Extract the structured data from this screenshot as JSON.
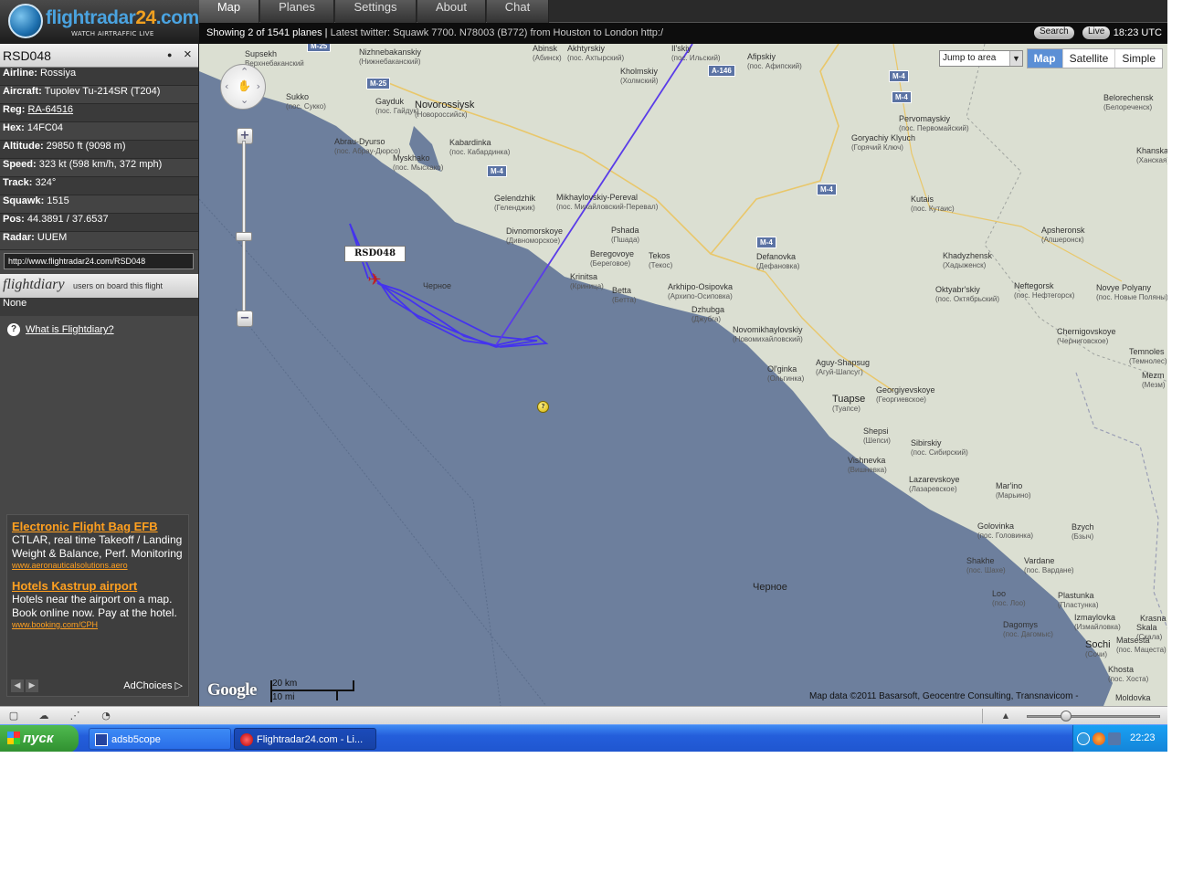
{
  "app": {
    "logo_text_a": "flightradar",
    "logo_text_b": "24",
    "logo_text_c": ".com",
    "logo_tagline": "WATCH AIRTRAFFIC LIVE"
  },
  "nav": {
    "tabs": [
      {
        "label": "Map",
        "active": true
      },
      {
        "label": "Planes"
      },
      {
        "label": "Settings"
      },
      {
        "label": "About"
      },
      {
        "label": "Chat"
      }
    ]
  },
  "status": {
    "showing": "Showing 2 of 1541 planes",
    "separator": "|",
    "twitter": "Latest twitter: Squawk 7700. N78003 (B772) from Houston to London http://t...",
    "search_label": "Search",
    "live_label": "Live",
    "clock": "18:23 UTC"
  },
  "flight": {
    "callsign": "RSD048",
    "pin_icon": "●",
    "close_icon": "×",
    "fields": [
      {
        "label": "Airline:",
        "value": "Rossiya"
      },
      {
        "label": "Aircraft:",
        "value": "Tupolev Tu-214SR (T204)"
      },
      {
        "label": "Reg:",
        "value": "RA-64516",
        "link": true
      },
      {
        "label": "Hex:",
        "value": "14FC04"
      },
      {
        "label": "Altitude:",
        "value": "29850 ft (9098 m)"
      },
      {
        "label": "Speed:",
        "value": "323 kt (598 km/h, 372 mph)"
      },
      {
        "label": "Track:",
        "value": "324°"
      },
      {
        "label": "Squawk:",
        "value": "1515"
      },
      {
        "label": "Pos:",
        "value": "44.3891 / 37.6537"
      },
      {
        "label": "Radar:",
        "value": "UUEM"
      }
    ],
    "url": "http://www.flightradar24.com/RSD048",
    "flightdiary_brand": "flightdiary",
    "flightdiary_desc": "users on board this flight",
    "flightdiary_value": "None",
    "flightdiary_help": "What is Flightdiary?"
  },
  "ads": {
    "items": [
      {
        "title": "Electronic Flight Bag EFB",
        "text": "CTLAR, real time Takeoff / Landing Weight & Balance, Perf. Monitoring",
        "url": "www.aeronauticalsolutions.aero"
      },
      {
        "title": "Hotels Kastrup airport",
        "text": "Hotels near the airport on a map. Book online now. Pay at the hotel.",
        "url": "www.booking.com/CPH"
      }
    ],
    "adchoices": "AdChoices ▷"
  },
  "map": {
    "jump_label": "Jump to area",
    "types": [
      {
        "label": "Map",
        "active": true
      },
      {
        "label": "Satellite"
      },
      {
        "label": "Simple"
      }
    ],
    "flight_label": "RSD048",
    "balloon": "?",
    "google": "Google",
    "scale_km": "20 km",
    "scale_mi": "10 mi",
    "attribution": "Map data ©2011 Basarsoft, Geocentre Consulting, Transnavicom -",
    "sea_label": "Черное",
    "sea_label_small": "Черное",
    "places": [
      {
        "name": "Supsekh",
        "ru": "Верхнебаканский"
      },
      {
        "name": "Nizhnebakanskiy",
        "ru": "(Нижнебаканский)"
      },
      {
        "name": "Abinsk",
        "ru": "(Абинск)"
      },
      {
        "name": "Akhtyrskiy",
        "ru": "(пос. Ахтырский)"
      },
      {
        "name": "Il'skiy",
        "ru": "(пос. Ильский)"
      },
      {
        "name": "Kholmskiy",
        "ru": "(Холмский)"
      },
      {
        "name": "Afipskiy",
        "ru": "(пос. Афипский)"
      },
      {
        "name": "Sukko",
        "ru": "(пос. Сукко)"
      },
      {
        "name": "Gayduk",
        "ru": "(пос. Гайдук)"
      },
      {
        "name": "Novorossiysk",
        "ru": "(Новороссийск)"
      },
      {
        "name": "Kabardinka",
        "ru": "(пос. Кабардинка)"
      },
      {
        "name": "Abrau-Dyurso",
        "ru": "(пос. Абрау-Дюрсо)"
      },
      {
        "name": "Myskhako",
        "ru": "(пос. Мысхако)"
      },
      {
        "name": "Gelendzhik",
        "ru": "(Геленджик)"
      },
      {
        "name": "Mikhaylovskiy-Pereval",
        "ru": "(пос. Михайловский-Перевал)"
      },
      {
        "name": "Divnomorskoye",
        "ru": "(Дивноморское)"
      },
      {
        "name": "Pshada",
        "ru": "(Пшада)"
      },
      {
        "name": "Beregovoye",
        "ru": "(Береговое)"
      },
      {
        "name": "Tekos",
        "ru": "(Текос)"
      },
      {
        "name": "Krinitsa",
        "ru": "(Криница)"
      },
      {
        "name": "Betta",
        "ru": "(Бетта)"
      },
      {
        "name": "Arkhipo-Osipovka",
        "ru": "(Архипо-Осиповка)"
      },
      {
        "name": "Dzhubga",
        "ru": "(Джубга)"
      },
      {
        "name": "Defanovka",
        "ru": "(Дефановка)"
      },
      {
        "name": "Novomikhaylovskiy",
        "ru": "(Новомихайловский)"
      },
      {
        "name": "Ol'ginka",
        "ru": "(Ольгинка)"
      },
      {
        "name": "Aguy-Shapsug",
        "ru": "(Агуй-Шапсуг)"
      },
      {
        "name": "Tuapse",
        "ru": "(Туапсе)"
      },
      {
        "name": "Georgiyevskoye",
        "ru": "(Георгиевское)"
      },
      {
        "name": "Shepsi",
        "ru": "(Шепси)"
      },
      {
        "name": "Sibirskiy",
        "ru": "(пос. Сибирский)"
      },
      {
        "name": "Vishnevka",
        "ru": "(Вишневка)"
      },
      {
        "name": "Lazarevskoye",
        "ru": "(Лазаревское)"
      },
      {
        "name": "Mar'ino",
        "ru": "(Марьино)"
      },
      {
        "name": "Golovinka",
        "ru": "(пос. Головинка)"
      },
      {
        "name": "Bzych",
        "ru": "(Бзыч)"
      },
      {
        "name": "Shakhe",
        "ru": "(пос. Шахе)"
      },
      {
        "name": "Vardane",
        "ru": "(пос. Вардане)"
      },
      {
        "name": "Loo",
        "ru": "(пос. Лоо)"
      },
      {
        "name": "Plastunka",
        "ru": "(Пластунка)"
      },
      {
        "name": "Dagomys",
        "ru": "(пос. Дагомыс)"
      },
      {
        "name": "Izmaylovka",
        "ru": "(Измайловка)"
      },
      {
        "name": "Sochi",
        "ru": "(Сочи)"
      },
      {
        "name": "Matsesta",
        "ru": "(пос. Мацеста)"
      },
      {
        "name": "Khosta",
        "ru": "(пос. Хоста)"
      },
      {
        "name": "Goryachiy Klyuch",
        "ru": "(Горячий Ключ)"
      },
      {
        "name": "Pervomayskiy",
        "ru": "(пос. Первомайский)"
      },
      {
        "name": "Kutais",
        "ru": "(пос. Кутаис)"
      },
      {
        "name": "Belorechensk",
        "ru": "(Белореченск)"
      },
      {
        "name": "Khanskaya",
        "ru": "(Ханская)"
      },
      {
        "name": "Apsheronsk",
        "ru": "(Апшеронск)"
      },
      {
        "name": "Khadyzhensk",
        "ru": "(Хадыженск)"
      },
      {
        "name": "Oktyabr'skiy",
        "ru": "(пос. Октябрьский)"
      },
      {
        "name": "Neftegorsk",
        "ru": "(пос. Нефтегорск)"
      },
      {
        "name": "Novye Polyany",
        "ru": "(пос. Новые Поляны)"
      },
      {
        "name": "Chernigovskoye",
        "ru": "(Черниговское)"
      },
      {
        "name": "Temnoles",
        "ru": "(Темнолес)"
      },
      {
        "name": "Mezm",
        "ru": "(Мезм)"
      },
      {
        "name": "Krasna",
        "ru": ""
      },
      {
        "name": "Skala",
        "ru": "(Скала)"
      },
      {
        "name": "Moldovka",
        "ru": ""
      }
    ],
    "highways": [
      "M-25",
      "M-25",
      "M-4",
      "A-146",
      "M-4",
      "M-4",
      "M-4",
      "M-4"
    ]
  },
  "footer": {
    "icons": [
      "window-icon",
      "cloud-icon",
      "share-icon",
      "gauge-icon"
    ]
  },
  "taskbar": {
    "start": "пуск",
    "tasks": [
      {
        "label": "adsb5cope"
      },
      {
        "label": "Flightradar24.com - Li..."
      }
    ],
    "time": "22:23"
  }
}
